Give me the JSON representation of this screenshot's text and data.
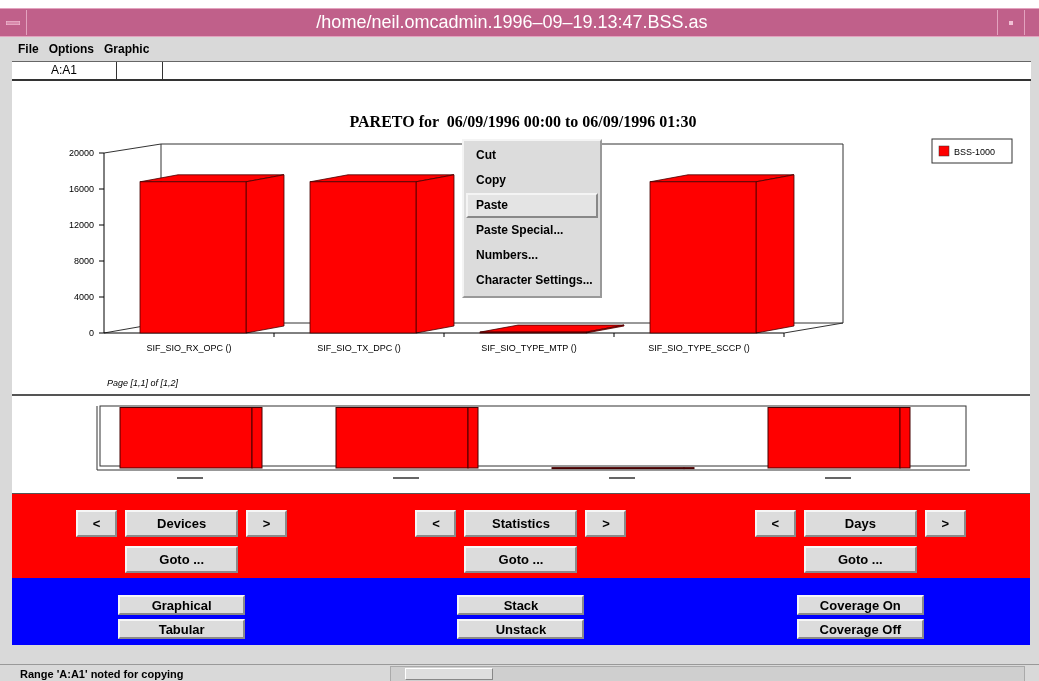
{
  "window": {
    "title": "/home/neil.omcadmin.1996–09–19.13:47.BSS.as"
  },
  "menu_bar": [
    "File",
    "Options",
    "Graphic"
  ],
  "cell_reference": "A:A1",
  "chart": {
    "chart_data": {
      "type": "bar",
      "title": "PARETO for  06/09/1996 00:00 to 06/09/1996 01:30",
      "categories": [
        "SIF_SIO_RX_OPC ()",
        "SIF_SIO_TX_DPC ()",
        "SIF_SIO_TYPE_MTP ()",
        "SIF_SIO_TYPE_SCCP ()"
      ],
      "series": [
        {
          "name": "BSS-1000",
          "color": "#ff0000",
          "values": [
            16800,
            16800,
            100,
            16800
          ]
        }
      ],
      "ylim": [
        0,
        20000
      ],
      "yticks": [
        0,
        4000,
        8000,
        12000,
        16000,
        20000
      ]
    },
    "page_label": "Page [1,1] of [1,2]"
  },
  "context_menu": [
    {
      "label": "Cut",
      "selected": false
    },
    {
      "label": "Copy",
      "selected": false
    },
    {
      "label": "Paste",
      "selected": true
    },
    {
      "label": "Paste Special...",
      "selected": false
    },
    {
      "label": "Numbers...",
      "selected": false
    },
    {
      "label": "Character Settings...",
      "selected": false
    }
  ],
  "navigators": [
    {
      "prev": "<",
      "label": "Devices",
      "next": ">",
      "goto": "Goto ..."
    },
    {
      "prev": "<",
      "label": "Statistics",
      "next": ">",
      "goto": "Goto ..."
    },
    {
      "prev": "<",
      "label": "Days",
      "next": ">",
      "goto": "Goto ..."
    }
  ],
  "view_buttons": [
    [
      "Graphical",
      "Tabular"
    ],
    [
      "Stack",
      "Unstack"
    ],
    [
      "Coverage On",
      "Coverage Off"
    ]
  ],
  "status_bar": {
    "text": "Range 'A:A1' noted for copying"
  }
}
